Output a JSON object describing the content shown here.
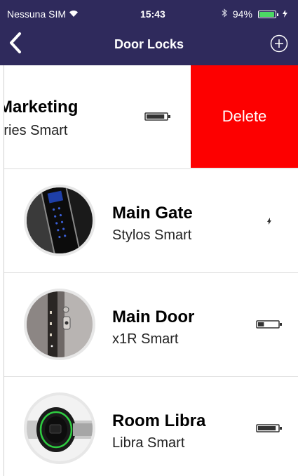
{
  "status_bar": {
    "carrier": "Nessuna SIM",
    "time": "15:43",
    "battery_percent": "94%",
    "battery_level": 0.94
  },
  "navbar": {
    "title": "Door Locks"
  },
  "colors": {
    "header_bg": "#2f2a5c",
    "delete_bg": "#fd0000",
    "battery_green": "#4cd964"
  },
  "locks": [
    {
      "name": "Marketing",
      "model": "Aries Smart",
      "status_icon": "battery-full-icon",
      "battery_level": 0.9,
      "swiped": true
    },
    {
      "name": "Main Gate",
      "model": "Stylos Smart",
      "status_icon": "power-connected-icon"
    },
    {
      "name": "Main Door",
      "model": "x1R Smart",
      "status_icon": "battery-low-icon",
      "battery_level": 0.3
    },
    {
      "name": "Room Libra",
      "model": "Libra Smart",
      "status_icon": "battery-full-icon",
      "battery_level": 0.9
    }
  ],
  "delete_label": "Delete"
}
